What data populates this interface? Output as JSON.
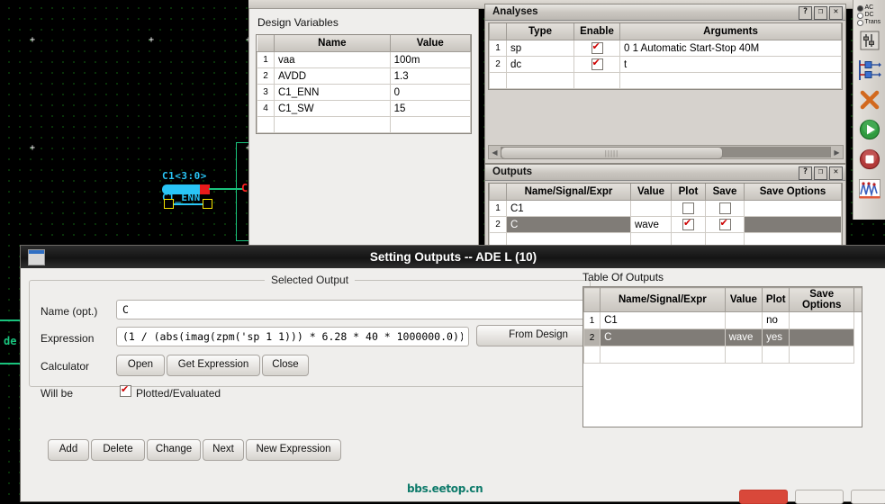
{
  "schematic": {
    "labels": [
      {
        "text": "C1<3:0>",
        "color": "#29c5f6"
      },
      {
        "text": "C1_ENN",
        "color": "#29c5f6"
      },
      {
        "text": "C",
        "color": "#ff2020"
      },
      {
        "text": "de",
        "color": "#19c37d"
      }
    ]
  },
  "design_variables": {
    "title": "Design Variables",
    "columns": [
      "Name",
      "Value"
    ],
    "rows": [
      {
        "n": "1",
        "name": "vaa",
        "value": "100m"
      },
      {
        "n": "2",
        "name": "AVDD",
        "value": "1.3"
      },
      {
        "n": "3",
        "name": "C1_ENN",
        "value": "0"
      },
      {
        "n": "4",
        "name": "C1_SW",
        "value": "15"
      }
    ]
  },
  "analyses": {
    "title": "Analyses",
    "columns": [
      "Type",
      "Enable",
      "Arguments"
    ],
    "rows": [
      {
        "n": "1",
        "type": "sp",
        "enable": true,
        "arguments": "0  1 Automatic Start-Stop 40M"
      },
      {
        "n": "2",
        "type": "dc",
        "enable": true,
        "arguments": "t"
      }
    ],
    "window_buttons": [
      "?",
      "❐",
      "✕"
    ]
  },
  "outputs": {
    "title": "Outputs",
    "columns": [
      "Name/Signal/Expr",
      "Value",
      "Plot",
      "Save",
      "Save Options"
    ],
    "rows": [
      {
        "n": "1",
        "name": "C1",
        "value": "",
        "plot": false,
        "save": false,
        "save_options": "",
        "selected": false
      },
      {
        "n": "2",
        "name": "C",
        "value": "wave",
        "plot": true,
        "save": true,
        "save_options": "",
        "selected": true
      }
    ],
    "window_buttons": [
      "?",
      "❐",
      "✕"
    ]
  },
  "toolbar_right": {
    "modes": [
      {
        "label": "AC",
        "selected": true
      },
      {
        "label": "DC",
        "selected": false
      },
      {
        "label": "Trans",
        "selected": false
      }
    ],
    "icons": [
      "variables-icon",
      "analyses-icon",
      "delete-icon",
      "run-icon",
      "stop-icon",
      "results-icon"
    ]
  },
  "dialog": {
    "title": "Setting Outputs -- ADE L (10)",
    "group_title": "Selected Output",
    "fields": {
      "name_label": "Name (opt.)",
      "name_value": "C",
      "expression_label": "Expression",
      "expression_value": "(1 / (abs(imag(zpm('sp 1 1))) * 6.28 * 40 * 1000000.0))",
      "from_design_label": "From Design",
      "calculator_label": "Calculator",
      "calculator_buttons": [
        "Open",
        "Get Expression",
        "Close"
      ],
      "willbe_label": "Will be",
      "willbe_checkbox_label": "Plotted/Evaluated",
      "willbe_checked": true
    },
    "action_buttons": [
      "Add",
      "Delete",
      "Change",
      "Next",
      "New Expression"
    ],
    "table_of_outputs": {
      "title": "Table Of Outputs",
      "columns": [
        "Name/Signal/Expr",
        "Value",
        "Plot",
        "Save Options"
      ],
      "rows": [
        {
          "n": "1",
          "name": "C1",
          "value": "",
          "plot": "no",
          "save_options": "",
          "selected": false
        },
        {
          "n": "2",
          "name": "C",
          "value": "wave",
          "plot": "yes",
          "save_options": "",
          "selected": true
        }
      ]
    }
  },
  "watermark": "bbs.eetop.cn"
}
